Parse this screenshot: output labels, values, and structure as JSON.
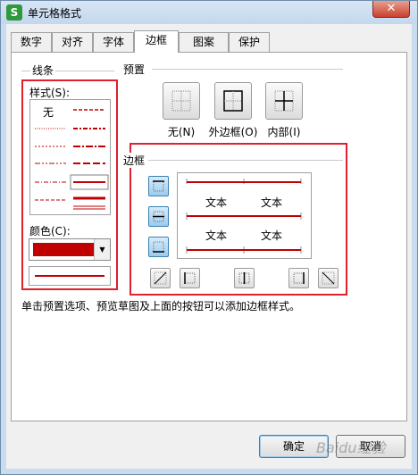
{
  "window": {
    "title": "单元格格式",
    "app_icon": "S",
    "close": "✕"
  },
  "tabs": [
    {
      "label": "数字"
    },
    {
      "label": "对齐"
    },
    {
      "label": "字体"
    },
    {
      "label": "边框"
    },
    {
      "label": "图案"
    },
    {
      "label": "保护"
    }
  ],
  "active_tab": "边框",
  "line_section": {
    "title": "线条",
    "style_label": "样式(S):",
    "none_label": "无",
    "color_label": "颜色(C):",
    "color_value": "#c00000"
  },
  "presets": {
    "title": "预置",
    "none": "无(N)",
    "outline": "外边框(O)",
    "inside": "内部(I)"
  },
  "border_section": {
    "title": "边框",
    "preview_texts": [
      "文本",
      "文本",
      "文本",
      "文本"
    ],
    "line_color": "#c00000"
  },
  "hint": "单击预置选项、预览草图及上面的按钮可以添加边框样式。",
  "buttons": {
    "ok": "确定",
    "cancel": "取消"
  },
  "watermark": "Baidu经验",
  "annotation_color": "#e0202e"
}
